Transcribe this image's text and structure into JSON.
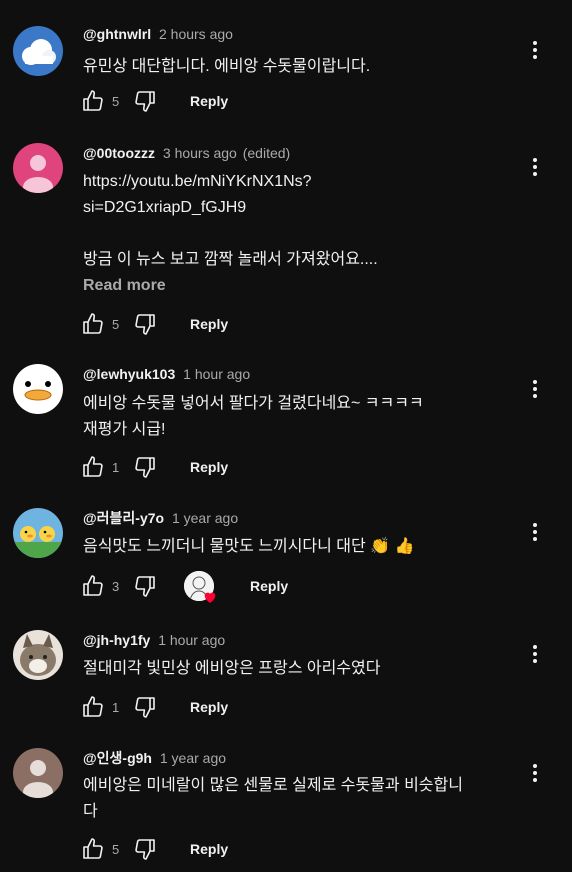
{
  "comments": [
    {
      "author": "@ghtnwlrl",
      "time": "2 hours ago",
      "edited": "",
      "text": [
        "유민상 대단합니다. 에비앙 수돗물이랍니다."
      ],
      "likes": "5",
      "reply": "Reply",
      "avatar": "sky-cloud-avatar"
    },
    {
      "author": "@00toozzz",
      "time": "3 hours ago",
      "edited": "(edited)",
      "text": [
        "https://youtu.be/mNiYKrNX1Ns?",
        "si=D2G1xriapD_fGJH9",
        "",
        "방금 이 뉴스 보고 깜짝 놀래서 가져왔어요...."
      ],
      "read_more": "Read more",
      "likes": "5",
      "reply": "Reply",
      "avatar": "pink-person-avatar"
    },
    {
      "author": "@lewhyuk103",
      "time": "1 hour ago",
      "edited": "",
      "text": [
        "에비앙 수돗물 넣어서 팔다가 걸렸다네요~ ㅋㅋㅋㅋ",
        "재평가 시급!"
      ],
      "likes": "1",
      "reply": "Reply",
      "avatar": "duck-avatar"
    },
    {
      "author": "@러블리-y7o",
      "time": "1 year ago",
      "edited": "",
      "text": [
        "음식맛도 느끼더니 물맛도 느끼시다니 대단 👏 👍"
      ],
      "likes": "3",
      "reply": "Reply",
      "avatar": "ducklings-avatar",
      "creator_heart": true
    },
    {
      "author": "@jh-hy1fy",
      "time": "1 hour ago",
      "edited": "",
      "text": [
        "절대미각 빛민상 에비앙은 프랑스 아리수였다"
      ],
      "likes": "1",
      "reply": "Reply",
      "avatar": "cat-avatar"
    },
    {
      "author": "@인생-g9h",
      "time": "1 year ago",
      "edited": "",
      "text": [
        "에비앙은 미네랄이 많은 센물로 실제로 수돗물과 비슷합니",
        "다"
      ],
      "likes": "5",
      "reply": "Reply",
      "avatar": "default-person-avatar"
    }
  ],
  "colors": {
    "background": "#0f0f0f",
    "text": "#f1f1f1",
    "secondary": "#aaaaaa",
    "heart": "#ff0033"
  }
}
